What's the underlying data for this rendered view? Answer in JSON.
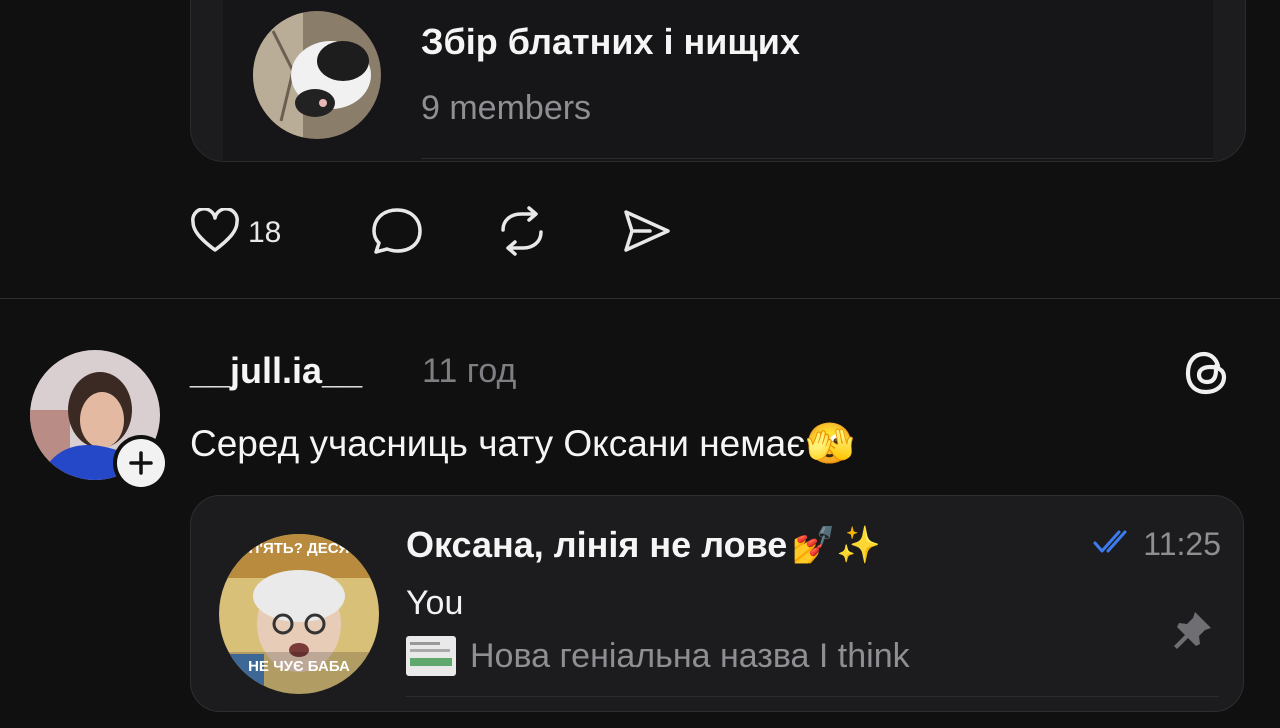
{
  "shared_group": {
    "title": "Збір блатних і нищих",
    "members": "9 members"
  },
  "actions": {
    "like_count": "18",
    "icons": [
      "heart-icon",
      "comment-icon",
      "repost-icon",
      "share-icon"
    ]
  },
  "post": {
    "username": "__jull.ia__",
    "time": "11 год",
    "text": "Серед учасниць чату Оксани немає",
    "text_emoji": "🫣",
    "follow_icon": "plus-icon",
    "brand_icon": "threads-logo-icon"
  },
  "chat": {
    "title": "Оксана, лінія не лове",
    "title_emoji": "💅✨",
    "time": "11:25",
    "sender": "You",
    "preview": "Нова геніальна назва I think",
    "avatar_caption_top": "П'ЯТЬ? ДЕСЯ",
    "avatar_caption_bottom": "НЕ ЧУЄ БАБА",
    "status_icon": "double-check-icon",
    "pin_icon": "pin-icon"
  },
  "colors": {
    "background": "#101010",
    "card": "#1c1c1e",
    "muted_text": "#8e8e93",
    "read_check": "#3d7bf0"
  }
}
